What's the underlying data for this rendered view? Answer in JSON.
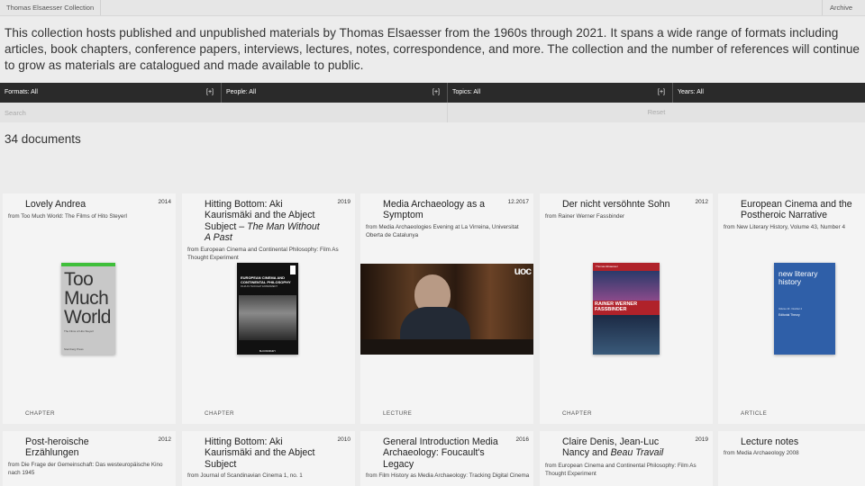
{
  "header": {
    "site_title": "Thomas Elsaesser Collection",
    "archive_label": "Archive"
  },
  "intro": "This collection hosts published and unpublished materials by Thomas Elsaesser from the 1960s through 2021. It spans a wide range of formats including articles, book chapters, conference papers, interviews, lectures, notes, correspondence, and more. The collection and the number of references will continue to grow as materials are catalogued and made available to public.",
  "filters": [
    {
      "label": "Formats: All",
      "plus": "[+]"
    },
    {
      "label": "People: All",
      "plus": "[+]"
    },
    {
      "label": "Topics: All",
      "plus": "[+]"
    },
    {
      "label": "Years: All"
    }
  ],
  "search": {
    "placeholder": "Search",
    "reset_label": "Reset"
  },
  "count": "34 documents",
  "cards": [
    {
      "title": "Lovely Andrea",
      "year": "2014",
      "source": "from Too Much World: The Films of Hito Steyerl",
      "type": "CHAPTER",
      "cover_text": "Too Much World",
      "cover_small": "The Films of Hito Steyerl",
      "cover_footer": "Sternberg Press"
    },
    {
      "title_pre": "Hitting Bottom: Aki Kaurismäki and the Abject Subject – ",
      "title_em": "The Man Without A Past",
      "year": "2019",
      "source": "from European Cinema and Continental Philosophy: Film As Thought Experiment",
      "type": "CHAPTER",
      "cover_text": "EUROPEAN CINEMA AND CONTINENTAL PHILOSOPHY",
      "cover_small": "FILM AS THOUGHT EXPERIMENT",
      "cover_footer": "BLOOMSBURY"
    },
    {
      "title": "Media Archaeology as a Symptom",
      "year": "12.2017",
      "source": "from Media Archaeologies Evening at La Virreina, Universitat Oberta de Catalunya",
      "type": "LECTURE",
      "cover_text": "uoc"
    },
    {
      "title": "Der nicht versöhnte Sohn",
      "year": "2012",
      "source": "from Rainer Werner Fassbinder",
      "type": "CHAPTER",
      "cover_text": "RAINER WERNER FASSBINDER",
      "cover_small": "Thomas Elsaesser"
    },
    {
      "title": "European Cinema and the Postheroic Narrative",
      "year": "",
      "source": "from New Literary History, Volume 43, Number 4",
      "type": "ARTICLE",
      "cover_text": "new literary history",
      "cover_small": "Volume 43 · Number 4",
      "cover_footer": "Editorial Theory"
    },
    {
      "title": "Post-heroische Erzählungen",
      "year": "2012",
      "source": "from Die Frage der Gemeinschaft: Das westeuropäische Kino nach 1945"
    },
    {
      "title": "Hitting Bottom: Aki Kaurismäki and the Abject Subject",
      "year": "2010",
      "source": "from Journal of Scandinavian Cinema 1, no. 1"
    },
    {
      "title": "General Introduction Media Archaeology: Foucault's Legacy",
      "year": "2016",
      "source": "from Film History as Media Archaeology: Tracking Digital Cinema"
    },
    {
      "title_pre": "Claire Denis, Jean-Luc Nancy and ",
      "title_em": "Beau Travail",
      "year": "2019",
      "source": "from European Cinema and Continental Philosophy: Film As Thought Experiment"
    },
    {
      "title": "Lecture notes",
      "year": "",
      "source": "from Media Archaeology 2008"
    }
  ]
}
